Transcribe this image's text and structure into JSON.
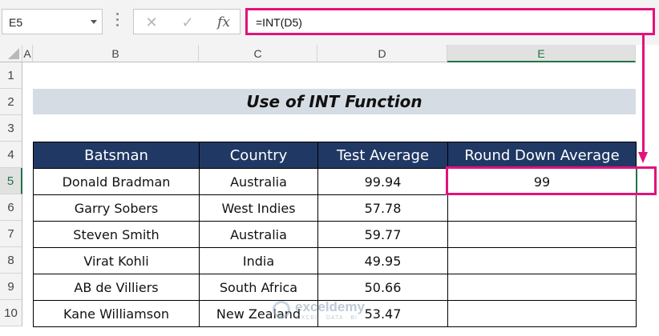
{
  "name_box": {
    "value": "E5"
  },
  "formula_bar": {
    "cancel_icon": "✕",
    "enter_icon": "✓",
    "fx_label": "fx",
    "formula": "=INT(D5)"
  },
  "columns": [
    "A",
    "B",
    "C",
    "D",
    "E"
  ],
  "selected_column": "E",
  "rows": [
    "1",
    "2",
    "3",
    "4",
    "5",
    "6",
    "7",
    "8",
    "9",
    "10"
  ],
  "selected_row": "5",
  "title": "Use of INT Function",
  "table": {
    "headers": [
      "Batsman",
      "Country",
      "Test Average",
      "Round Down Average"
    ],
    "rows": [
      [
        "Donald Bradman",
        "Australia",
        "99.94",
        "99"
      ],
      [
        "Garry Sobers",
        "West Indies",
        "57.78",
        ""
      ],
      [
        "Steven Smith",
        "Australia",
        "59.77",
        ""
      ],
      [
        "Virat Kohli",
        "India",
        "49.95",
        ""
      ],
      [
        "AB de Villiers",
        "South Africa",
        "50.66",
        ""
      ],
      [
        "Kane Williamson",
        "New Zealand",
        "53.47",
        ""
      ]
    ]
  },
  "watermark": {
    "name": "exceldemy",
    "tagline": "EXCEL · DATA · BI"
  },
  "colors": {
    "header_fill": "#203864",
    "title_fill": "#d6dce4",
    "highlight": "#e3127c",
    "selection": "#217346"
  }
}
